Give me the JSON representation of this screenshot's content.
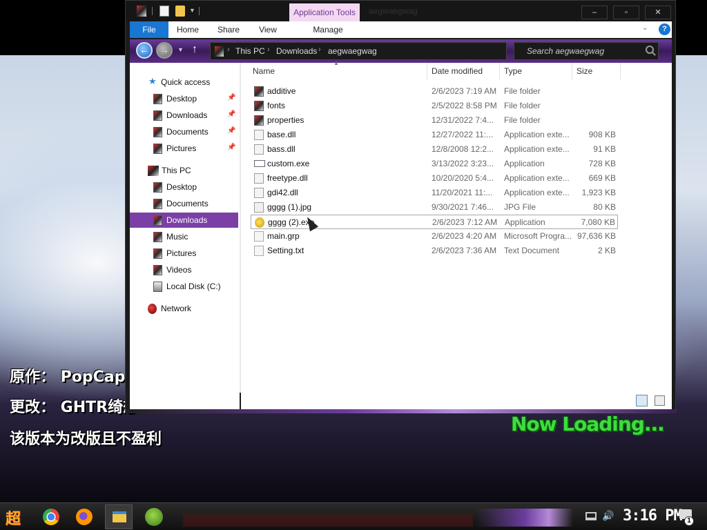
{
  "desktop": {
    "credit_author_line": "原作：  PopCap Ga",
    "credit_mod_line": "更改：  GHTR绮想",
    "credit_notice_line": "该版本为改版且不盈利",
    "loading_text": "Now Loading..."
  },
  "window": {
    "app_tools_label": "Application Tools",
    "title": "aegwaegwag",
    "ribbon": {
      "file": "File",
      "home": "Home",
      "share": "Share",
      "view": "View",
      "manage": "Manage",
      "help": "?"
    },
    "address": {
      "crumbs": [
        "This PC",
        "Downloads",
        "aegwaegwag"
      ],
      "search_placeholder": "Search aegwaegwag"
    },
    "nav": {
      "quick_access": "Quick access",
      "quick_items": [
        "Desktop",
        "Downloads",
        "Documents",
        "Pictures"
      ],
      "this_pc": "This PC",
      "pc_items": [
        "Desktop",
        "Documents",
        "Downloads",
        "Music",
        "Pictures",
        "Videos",
        "Local Disk (C:)"
      ],
      "selected": "Downloads",
      "network": "Network"
    },
    "columns": [
      "Name",
      "Date modified",
      "Type",
      "Size"
    ],
    "files": [
      {
        "name": "additive",
        "date": "2/6/2023 7:19 AM",
        "type": "File folder",
        "size": "",
        "icon": "folder-icon"
      },
      {
        "name": "fonts",
        "date": "2/5/2022 8:58 PM",
        "type": "File folder",
        "size": "",
        "icon": "folder-icon"
      },
      {
        "name": "properties",
        "date": "12/31/2022 7:4...",
        "type": "File folder",
        "size": "",
        "icon": "folder-icon"
      },
      {
        "name": "base.dll",
        "date": "12/27/2022 11:...",
        "type": "Application exte...",
        "size": "908 KB",
        "icon": "dll-icon"
      },
      {
        "name": "bass.dll",
        "date": "12/8/2008 12:2...",
        "type": "Application exte...",
        "size": "91 KB",
        "icon": "dll-icon"
      },
      {
        "name": "custom.exe",
        "date": "3/13/2022 3:23...",
        "type": "Application",
        "size": "728 KB",
        "icon": "exe-icon"
      },
      {
        "name": "freetype.dll",
        "date": "10/20/2020 5:4...",
        "type": "Application exte...",
        "size": "669 KB",
        "icon": "dll-icon"
      },
      {
        "name": "gdi42.dll",
        "date": "11/20/2021 11:...",
        "type": "Application exte...",
        "size": "1,923 KB",
        "icon": "dll-icon"
      },
      {
        "name": "gggg (1).jpg",
        "date": "9/30/2021 7:46...",
        "type": "JPG File",
        "size": "80 KB",
        "icon": "image-icon"
      },
      {
        "name": "gggg (2).exe",
        "date": "2/6/2023 7:12 AM",
        "type": "Application",
        "size": "7,080 KB",
        "icon": "duck-app-icon"
      },
      {
        "name": "main.grp",
        "date": "2/6/2023 4:20 AM",
        "type": "Microsoft Progra...",
        "size": "97,636 KB",
        "icon": "file-icon"
      },
      {
        "name": "Setting.txt",
        "date": "2/6/2023 7:36 AM",
        "type": "Text Document",
        "size": "2 KB",
        "icon": "text-file-icon"
      }
    ],
    "selected_file": "gggg (2).exe"
  },
  "taskbar": {
    "start_label": "超",
    "clock": "3:16 PM",
    "notification_count": "1"
  }
}
